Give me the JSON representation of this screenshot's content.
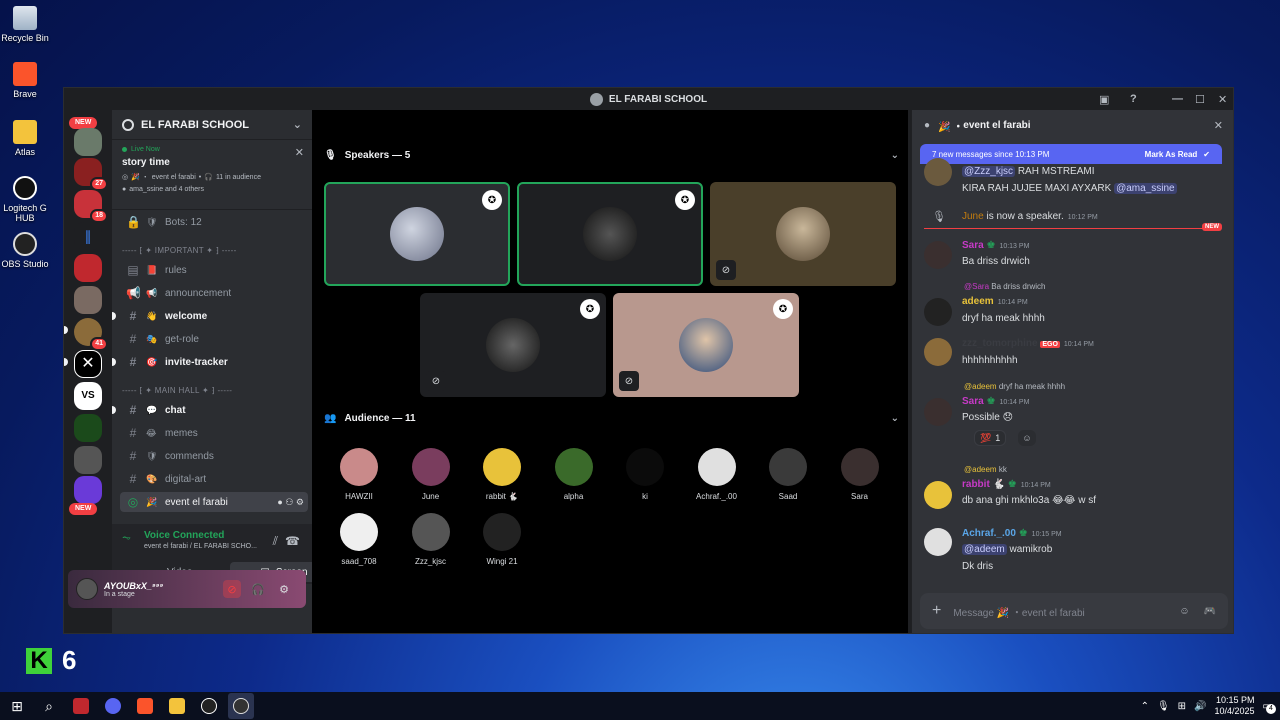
{
  "desktop": {
    "icons": [
      {
        "label": "Recycle Bin",
        "icon": "recycle-bin-icon"
      },
      {
        "label": "Brave",
        "icon": "brave-icon"
      },
      {
        "label": "Atlas",
        "icon": "folder-icon"
      },
      {
        "label": "Logitech G HUB",
        "icon": "logitech-icon"
      },
      {
        "label": "OBS Studio",
        "icon": "obs-icon"
      }
    ],
    "overlay_k": "K",
    "overlay_num": "6"
  },
  "window": {
    "title": "EL FARABI SCHOOL"
  },
  "rail": {
    "new_label_top": "NEW",
    "new_label_bottom": "NEW",
    "badges": [
      "27",
      "18",
      "41"
    ]
  },
  "channels": {
    "server_name": "EL FARABI SCHOOL",
    "live_now": "Live Now",
    "stage_title": "story time",
    "stage_meta": "event el farabi",
    "audience_meta": "11 in audience",
    "speakers_meta": "ama_ssine and 4 others",
    "items": [
      {
        "name": "Bots: 12",
        "emoji": "🛡"
      },
      {
        "name": "rules",
        "emoji": "📕"
      },
      {
        "name": "announcement",
        "emoji": "📢"
      },
      {
        "name": "welcome",
        "emoji": "👋"
      },
      {
        "name": "get-role",
        "emoji": "🎭"
      },
      {
        "name": "invite-tracker",
        "emoji": "🎯"
      },
      {
        "name": "chat",
        "emoji": "💬"
      },
      {
        "name": "memes",
        "emoji": "😂"
      },
      {
        "name": "commends",
        "emoji": "🛡"
      },
      {
        "name": "digital-art",
        "emoji": "🎨"
      },
      {
        "name": "event el farabi",
        "emoji": "🎉"
      }
    ],
    "category_important": "----- ⁅ ✦ IMPORTANT ✦ ⁆ -----",
    "category_main": "----- ⁅ ✦ MAIN HALL ✦ ⁆ -----"
  },
  "voice": {
    "status": "Voice Connected",
    "location": "event el farabi / EL FARABI SCHO...",
    "video_label": "Video",
    "screen_label": "Screen"
  },
  "user": {
    "name": "AYOUBxX_⁹⁹⁹",
    "status": "In a stage"
  },
  "stage": {
    "speakers_header": "Speakers — 5",
    "audience_header": "Audience — 11",
    "audience": [
      {
        "name": "HAWZII",
        "color": "#c98a8a"
      },
      {
        "name": "June",
        "color": "#7a3d5e"
      },
      {
        "name": "rabbit 🐇",
        "color": "#e8c23a"
      },
      {
        "name": "alpha",
        "color": "#3a6a2a"
      },
      {
        "name": "ki",
        "color": "#0b0b0b"
      },
      {
        "name": "Achraf._.00",
        "color": "#e0e0e0"
      },
      {
        "name": "Saad",
        "color": "#3a3a3a"
      },
      {
        "name": "Sara",
        "color": "#3a2f2f"
      },
      {
        "name": "saad_708",
        "color": "#efefef"
      },
      {
        "name": "Zzz_kjsc",
        "color": "#555"
      },
      {
        "name": "Wingi 21",
        "color": "#222"
      }
    ]
  },
  "chat": {
    "channel": "event el farabi",
    "new_messages": "7 new messages since 10:13 PM",
    "mark_read": "Mark As Read",
    "new_tag": "NEW",
    "msg0_line1_mention": "@Zzz_kjsc",
    "msg0_line1_text": " RAH MSTREAMI",
    "msg0_line2_text": "KIRA RAH JUJEE MAXI AYXARK ",
    "msg0_line2_mention": "@ama_ssine",
    "sys_name": "June",
    "sys_text": " is now a speaker.",
    "sys_time": "10:12 PM",
    "m1_name": "Sara",
    "m1_time": "10:13 PM",
    "m1_text": "Ba driss drwich",
    "m2_reply_name": "@Sara",
    "m2_reply_text": "Ba driss drwich",
    "m2_name": "adeem",
    "m2_time": "10:14 PM",
    "m2_text": "dryf ha meak hhhh",
    "m3_name": "zzz_tomorphine",
    "m3_tag": "EGO",
    "m3_time": "10:14 PM",
    "m3_text": "hhhhhhhhhh",
    "m4_reply_name": "@adeem",
    "m4_reply_text": "dryf ha meak hhhh",
    "m4_name": "Sara",
    "m4_time": "10:14 PM",
    "m4_text": "Possible 😞",
    "m4_react_count": "1",
    "m5_reply_name": "@adeem",
    "m5_reply_text": "kk",
    "m5_name": "rabbit 🐇",
    "m5_time": "10:14 PM",
    "m5_text": "db ana ghi mkhlo3a 😂😂 w sf",
    "m6_name": "Achraf._.00",
    "m6_time": "10:15 PM",
    "m6_mention": "@adeem",
    "m6_text": " wamikrob",
    "m6_text2": "Dk dris",
    "input_placeholder": "Message 🎉 ・event el farabi"
  },
  "taskbar": {
    "time": "10:15 PM",
    "date": "10/4/2025",
    "notif": "4"
  }
}
